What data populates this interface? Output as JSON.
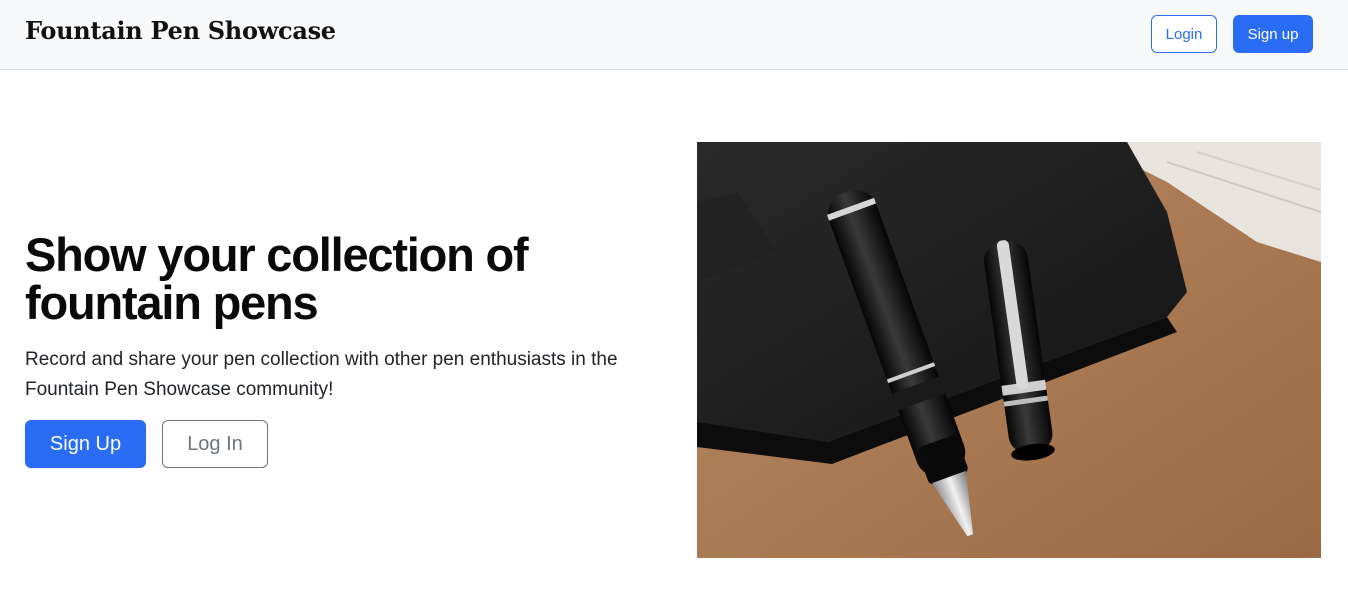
{
  "navbar": {
    "brand": "Fountain Pen Showcase",
    "login_label": "Login",
    "signup_label": "Sign up"
  },
  "hero": {
    "title": "Show your collection of fountain pens",
    "subtitle": "Record and share your pen collection with other pen enthusiasts in the Fountain Pen Showcase community!",
    "signup_label": "Sign Up",
    "login_label": "Log In",
    "image_subject": "fountain-pen-on-notebook-photo"
  },
  "colors": {
    "accent": "#2a6df4",
    "navbar_bg": "#f8f9fa",
    "secondary": "#6c757d"
  }
}
